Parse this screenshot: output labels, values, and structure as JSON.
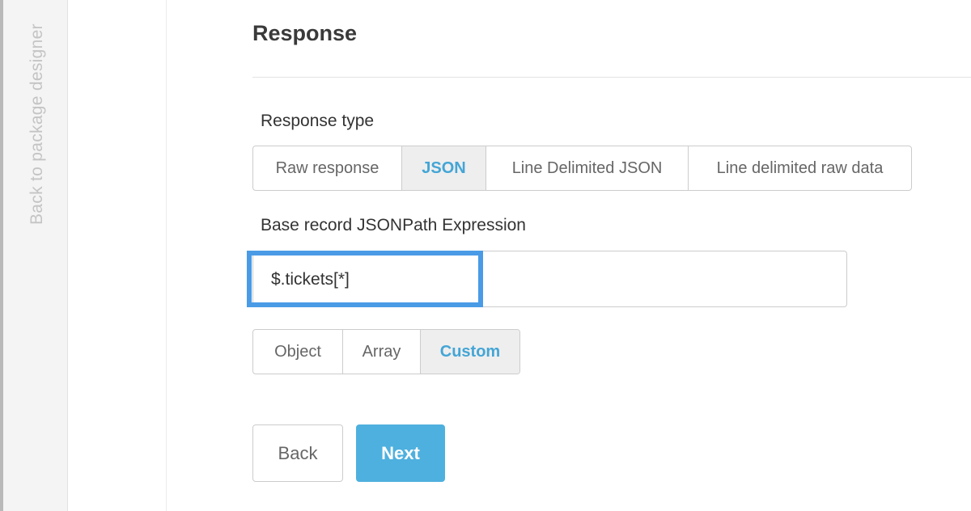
{
  "back_strip": {
    "label": "Back to package designer"
  },
  "section": {
    "title": "Response"
  },
  "response_type": {
    "label": "Response type",
    "options": [
      "Raw response",
      "JSON",
      "Line Delimited JSON",
      "Line delimited raw data"
    ],
    "selected": "JSON"
  },
  "jsonpath": {
    "label": "Base record JSONPath Expression",
    "value": "$.tickets[*]"
  },
  "record_kind": {
    "options": [
      "Object",
      "Array",
      "Custom"
    ],
    "selected": "Custom"
  },
  "buttons": {
    "back": "Back",
    "next": "Next"
  },
  "colors": {
    "accent": "#44a5d6",
    "next_button": "#4eb0de",
    "focus_ring": "#4a9be6"
  }
}
